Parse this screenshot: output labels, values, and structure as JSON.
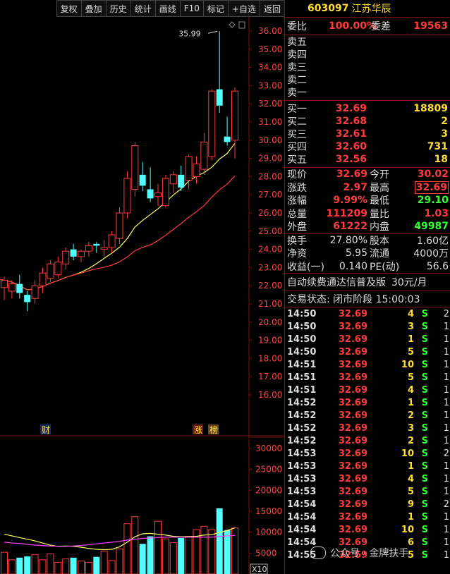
{
  "toolbar": {
    "items": [
      "复权",
      "叠加",
      "历史",
      "统计",
      "画线",
      "F10",
      "标记",
      "+自选",
      "返回"
    ]
  },
  "stock": {
    "code": "603097",
    "name": "江苏华辰"
  },
  "chart_data": [
    {
      "type": "candlestick",
      "title": "",
      "price_axis": {
        "ticks": [
          "36.00",
          "35.00",
          "34.00",
          "33.00",
          "32.00",
          "31.00",
          "30.00",
          "29.00",
          "28.00",
          "27.00",
          "26.00",
          "25.00",
          "24.00",
          "23.00",
          "22.00",
          "21.00",
          "20.00",
          "19.00",
          "18.00",
          "17.00",
          "16.00"
        ],
        "ylim": [
          15.0,
          36.5
        ]
      },
      "high_label": "35.99",
      "candles": [
        {
          "o": 21.9,
          "h": 22.5,
          "l": 21.2,
          "c": 22.3
        },
        {
          "o": 21.7,
          "h": 22.3,
          "l": 21.3,
          "c": 22.1
        },
        {
          "o": 22.1,
          "h": 22.6,
          "l": 21.3,
          "c": 21.6
        },
        {
          "o": 21.5,
          "h": 21.7,
          "l": 20.6,
          "c": 21.1
        },
        {
          "o": 21.3,
          "h": 22.3,
          "l": 21.0,
          "c": 22.0
        },
        {
          "o": 22.0,
          "h": 23.0,
          "l": 21.6,
          "c": 22.7
        },
        {
          "o": 22.4,
          "h": 23.4,
          "l": 22.2,
          "c": 23.2
        },
        {
          "o": 22.6,
          "h": 23.6,
          "l": 22.4,
          "c": 23.3
        },
        {
          "o": 23.2,
          "h": 24.1,
          "l": 22.9,
          "c": 23.9
        },
        {
          "o": 24.0,
          "h": 24.3,
          "l": 23.4,
          "c": 23.6
        },
        {
          "o": 23.6,
          "h": 24.0,
          "l": 23.3,
          "c": 23.9
        },
        {
          "o": 23.9,
          "h": 24.4,
          "l": 23.6,
          "c": 24.2
        },
        {
          "o": 24.3,
          "h": 24.4,
          "l": 23.8,
          "c": 24.2
        },
        {
          "o": 24.0,
          "h": 24.5,
          "l": 23.6,
          "c": 24.1
        },
        {
          "o": 24.1,
          "h": 25.0,
          "l": 23.8,
          "c": 24.8
        },
        {
          "o": 24.6,
          "h": 26.3,
          "l": 24.3,
          "c": 26.0
        },
        {
          "o": 26.0,
          "h": 28.3,
          "l": 25.7,
          "c": 27.9
        },
        {
          "o": 27.3,
          "h": 29.9,
          "l": 26.9,
          "c": 29.7
        },
        {
          "o": 28.1,
          "h": 28.8,
          "l": 27.2,
          "c": 27.5
        },
        {
          "o": 27.3,
          "h": 28.5,
          "l": 26.6,
          "c": 26.8
        },
        {
          "o": 26.9,
          "h": 27.6,
          "l": 26.4,
          "c": 27.1
        },
        {
          "o": 26.4,
          "h": 28.1,
          "l": 26.3,
          "c": 27.9
        },
        {
          "o": 27.6,
          "h": 28.3,
          "l": 27.1,
          "c": 28.1
        },
        {
          "o": 28.1,
          "h": 28.6,
          "l": 27.2,
          "c": 27.4
        },
        {
          "o": 27.8,
          "h": 29.2,
          "l": 27.3,
          "c": 29.1
        },
        {
          "o": 28.0,
          "h": 29.1,
          "l": 27.6,
          "c": 28.7
        },
        {
          "o": 28.4,
          "h": 30.4,
          "l": 28.1,
          "c": 29.9
        },
        {
          "o": 29.1,
          "h": 32.8,
          "l": 28.9,
          "c": 32.7
        },
        {
          "o": 32.8,
          "h": 35.99,
          "l": 31.5,
          "c": 31.9
        },
        {
          "o": 30.2,
          "h": 31.3,
          "l": 29.7,
          "c": 29.9
        },
        {
          "o": 30.0,
          "h": 32.9,
          "l": 29.0,
          "c": 32.7
        }
      ],
      "labels": {
        "cai": "财",
        "zhang": "涨",
        "bang": "榜"
      }
    },
    {
      "type": "bar",
      "title": "",
      "volume_axis": {
        "ticks": [
          "30000",
          "25000",
          "20000",
          "15000",
          "10000",
          "5000"
        ],
        "ylim": [
          0,
          32000
        ],
        "multiplier": "X10"
      },
      "volumes": [
        5200,
        3400,
        3900,
        4200,
        4600,
        3400,
        4800,
        2800,
        3600,
        3900,
        3100,
        2800,
        4100,
        5500,
        3200,
        6000,
        12000,
        13700,
        7200,
        9000,
        12600,
        8400,
        7500,
        8600,
        9000,
        10600,
        11400,
        10600,
        15700,
        10500,
        11000
      ],
      "ma_yellow": [
        9500,
        9100,
        8700,
        8300,
        7900,
        7400,
        6900,
        6600,
        6700,
        6600,
        6400,
        6100,
        5900,
        5800,
        5900,
        6500,
        7600,
        8900,
        9600,
        9700,
        9500,
        9300,
        9000,
        8900,
        8900,
        9000,
        9300,
        9400,
        9900,
        10400,
        11000
      ],
      "ma_magenta": [
        7600,
        7400,
        7300,
        7100,
        6900,
        6800,
        6700,
        6600,
        6600,
        6700,
        6800,
        7000,
        7200,
        7400,
        7600,
        7800,
        8100,
        8300,
        8500,
        8600,
        8700,
        8800,
        8800,
        8800,
        8800,
        8800,
        8800,
        8800,
        9000,
        9100,
        9200
      ]
    }
  ],
  "quote": {
    "weibi_label": "委比",
    "weibi_val": "100.00%",
    "weicha_label": "委差",
    "weicha_val": "19563",
    "sells": [
      {
        "label": "卖五",
        "price": "",
        "vol": ""
      },
      {
        "label": "卖四",
        "price": "",
        "vol": ""
      },
      {
        "label": "卖三",
        "price": "",
        "vol": ""
      },
      {
        "label": "卖二",
        "price": "",
        "vol": ""
      },
      {
        "label": "卖一",
        "price": "",
        "vol": ""
      }
    ],
    "buys": [
      {
        "label": "买一",
        "price": "32.69",
        "vol": "18809"
      },
      {
        "label": "买二",
        "price": "32.68",
        "vol": "2"
      },
      {
        "label": "买三",
        "price": "32.61",
        "vol": "3"
      },
      {
        "label": "买四",
        "price": "32.60",
        "vol": "731"
      },
      {
        "label": "买五",
        "price": "32.56",
        "vol": "18"
      }
    ],
    "stats1": [
      {
        "l1": "现价",
        "v1": "32.69",
        "l2": "今开",
        "v2": "30.02",
        "c2": "red"
      },
      {
        "l1": "涨跌",
        "v1": "2.97",
        "l2": "最高",
        "v2": "32.69",
        "c2": "red-box"
      },
      {
        "l1": "涨幅",
        "v1": "9.99%",
        "l2": "最低",
        "v2": "29.10",
        "c2": "grn"
      },
      {
        "l1": "总量",
        "v1": "111209",
        "l2": "量比",
        "v2": "1.03",
        "c2": "red"
      },
      {
        "l1": "外盘",
        "v1": "61222",
        "l2": "内盘",
        "v2": "49987",
        "c2": "grn"
      }
    ],
    "stats2": [
      {
        "l1": "换手",
        "v1": "27.80%",
        "l2": "股本",
        "v2": "1.60亿"
      },
      {
        "l1": "净资",
        "v1": "5.95",
        "l2": "流通",
        "v2": "4000万"
      },
      {
        "l1": "收益(一)",
        "v1": "0.140",
        "l2": "PE(动)",
        "v2": "56.6"
      }
    ],
    "ad": "自动续费通达信普及版",
    "ad_price": "30元/月",
    "status": "交易状态: 闭市阶段 15:00:03"
  },
  "ticks": [
    {
      "t": "14:50",
      "p": "32.69",
      "v": "4",
      "s": "S",
      "n": "2"
    },
    {
      "t": "14:50",
      "p": "32.69",
      "v": "3",
      "s": "S",
      "n": "1"
    },
    {
      "t": "14:50",
      "p": "32.69",
      "v": "1",
      "s": "S",
      "n": "1"
    },
    {
      "t": "14:50",
      "p": "32.69",
      "v": "5",
      "s": "S",
      "n": "1"
    },
    {
      "t": "14:51",
      "p": "32.69",
      "v": "10",
      "s": "S",
      "n": "1"
    },
    {
      "t": "14:51",
      "p": "32.69",
      "v": "5",
      "s": "S",
      "n": "1"
    },
    {
      "t": "14:51",
      "p": "32.69",
      "v": "4",
      "s": "S",
      "n": "1"
    },
    {
      "t": "14:52",
      "p": "32.69",
      "v": "1",
      "s": "S",
      "n": "1"
    },
    {
      "t": "14:52",
      "p": "32.69",
      "v": "2",
      "s": "S",
      "n": "1"
    },
    {
      "t": "14:52",
      "p": "32.69",
      "v": "3",
      "s": "S",
      "n": "1"
    },
    {
      "t": "14:52",
      "p": "32.69",
      "v": "2",
      "s": "S",
      "n": "1"
    },
    {
      "t": "14:53",
      "p": "32.69",
      "v": "10",
      "s": "S",
      "n": "2"
    },
    {
      "t": "14:53",
      "p": "32.69",
      "v": "1",
      "s": "S",
      "n": "1"
    },
    {
      "t": "14:53",
      "p": "32.69",
      "v": "4",
      "s": "S",
      "n": "1"
    },
    {
      "t": "14:53",
      "p": "32.69",
      "v": "5",
      "s": "S",
      "n": "1"
    },
    {
      "t": "14:54",
      "p": "32.69",
      "v": "9",
      "s": "S",
      "n": "2"
    },
    {
      "t": "14:54",
      "p": "32.69",
      "v": "1",
      "s": "S",
      "n": "1"
    },
    {
      "t": "14:54",
      "p": "32.69",
      "v": "10",
      "s": "S",
      "n": "1"
    },
    {
      "t": "14:54",
      "p": "32.69",
      "v": "6",
      "s": "S",
      "n": "1"
    },
    {
      "t": "14:55",
      "p": "32.69",
      "v": "5",
      "s": "S",
      "n": "1"
    }
  ],
  "watermark": "公众号 · 金牌扶手",
  "colors": {
    "up": "#ff3b3b",
    "down": "#54ffff",
    "ma_yellow": "#ffff66",
    "ma_red": "#ff3b3b",
    "ma_magenta": "#ff44ff",
    "grid": "#7a1010",
    "bg": "#000000"
  }
}
